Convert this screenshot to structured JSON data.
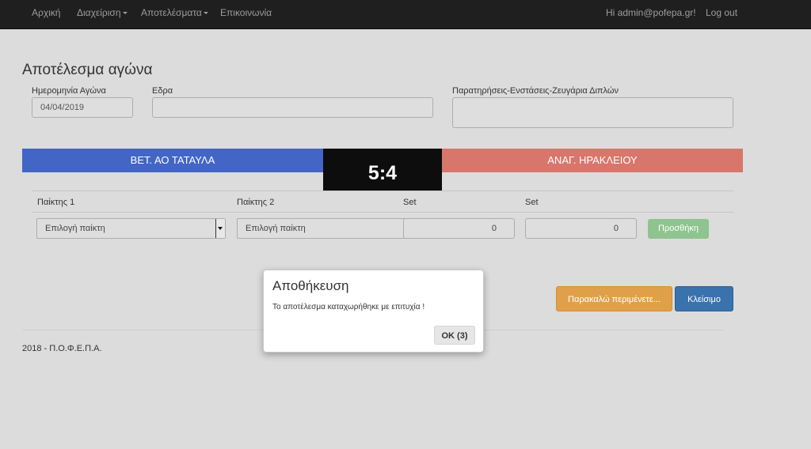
{
  "nav": {
    "home": "Αρχική",
    "management": "Διαχείριση",
    "results": "Αποτελέσματα",
    "contact": "Επικοινωνία",
    "greeting": "Hi admin@pofepa.gr!",
    "logout": "Log out"
  },
  "page": {
    "title": "Αποτέλεσμα αγώνα",
    "date_label": "Ημερομηνία Αγώνα",
    "date_value": "04/04/2019",
    "venue_label": "Εδρα",
    "venue_value": "",
    "notes_label": "Παρατηρήσεις-Ενστάσεις-Ζευγάρια Διπλών",
    "notes_value": ""
  },
  "match": {
    "home_team": "ΒΕΤ. ΑΟ ΤΑΤΑΥΛΑ",
    "away_team": "ΑΝΑΓ. ΗΡΑΚΛΕΙΟΥ",
    "score": "5:4"
  },
  "games": {
    "headers": [
      "Παίκτης 1",
      "Παίκτης 2",
      "Set",
      "Set"
    ],
    "player1_select": "Επιλογή παίκτη",
    "player2_select": "Επιλογή παίκτη",
    "set1": "0",
    "set2": "0",
    "add_button": "Προσθήκη"
  },
  "actions": {
    "wait_button": "Παρακαλώ περιμένετε...",
    "close_button": "Κλείσιμο"
  },
  "footer": {
    "text": "2018 - Π.Ο.Φ.Ε.Π.Α."
  },
  "modal": {
    "title": "Αποθήκευση",
    "message": "Το αποτέλεσμα καταχωρήθηκε με επιτυχία !",
    "ok_button": "OK (3)"
  },
  "colors": {
    "home_team": "#4265c6",
    "away_team": "#d9766b",
    "score_bg": "#0d0d0d",
    "navbar": "#1f1f1f",
    "add_button": "#8fc38f",
    "wait_button": "#e0a04a",
    "close_button": "#3a72ad"
  }
}
